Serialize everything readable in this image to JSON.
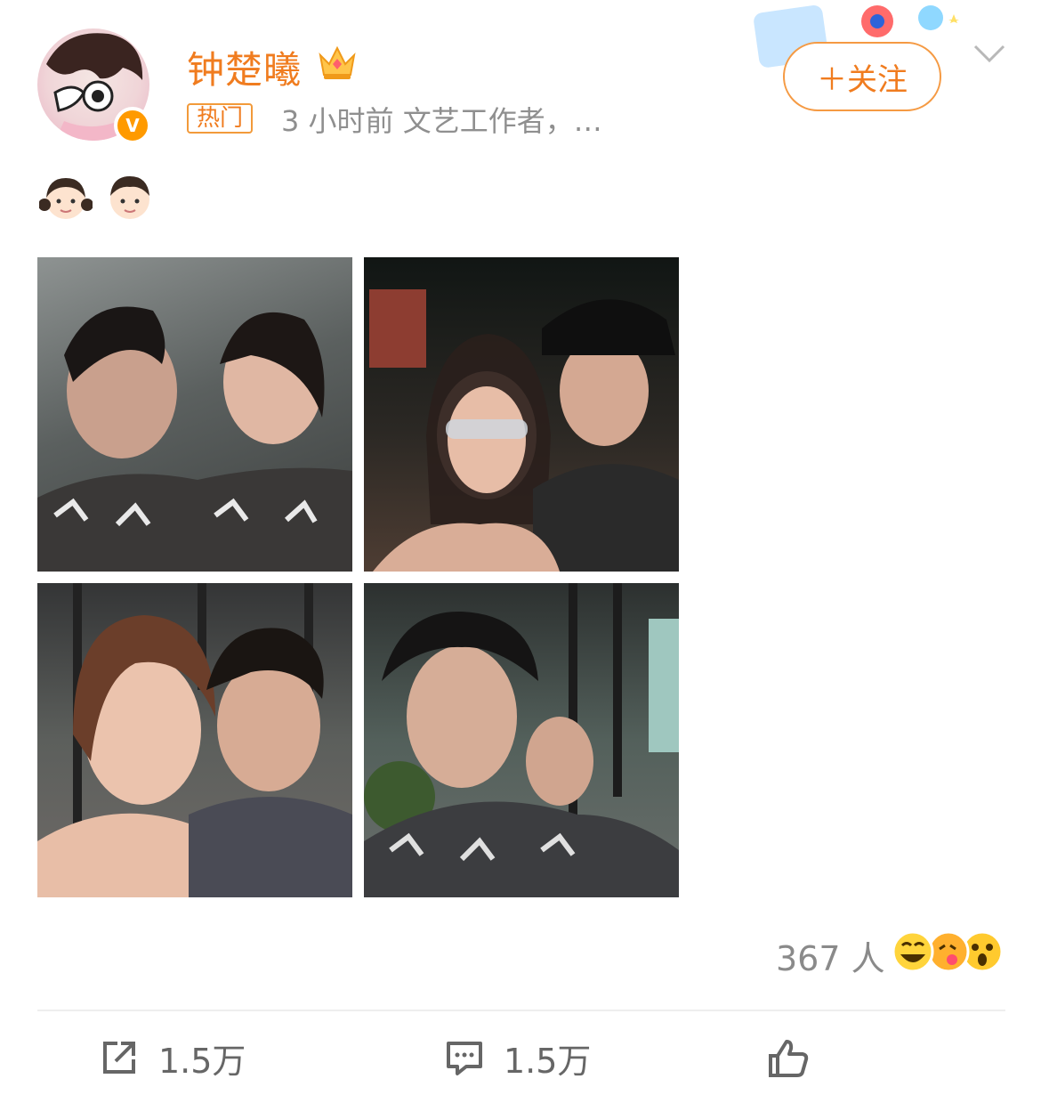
{
  "post": {
    "author": {
      "name": "钟楚曦",
      "avatar_icon": "avatar-cartoon",
      "verified_icon": "verified-v-badge",
      "verified_label": "V",
      "member_icon": "crown-icon"
    },
    "hot_tag": "热门",
    "meta": "3 小时前  文艺工作者，…",
    "follow_label": "＋关注",
    "body_emojis": [
      "girl-face-emoji",
      "boy-face-emoji"
    ],
    "photos": [
      {
        "icon": "photo-selfie-1"
      },
      {
        "icon": "photo-selfie-2"
      },
      {
        "icon": "photo-selfie-3"
      },
      {
        "icon": "photo-selfie-4"
      }
    ],
    "reactions": {
      "count_label": "367 人",
      "emoji_icons": [
        "laugh-emoji",
        "kiss-emoji",
        "shock-emoji"
      ]
    },
    "actions": {
      "repost": "1.5万",
      "comment": "1.5万",
      "like": ""
    },
    "colors": {
      "accent": "#f07c1f",
      "meta_gray": "#8f8f8f"
    }
  }
}
